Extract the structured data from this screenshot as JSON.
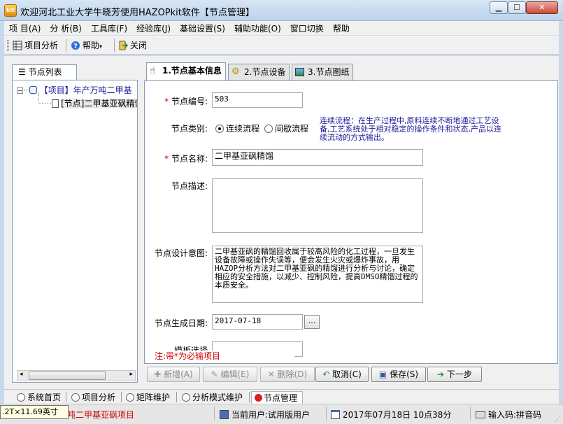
{
  "window": {
    "title": "欢迎河北工业大学牛晓芳使用HAZOPkit软件【节点管理】",
    "app_icon_text": "kit"
  },
  "menu": [
    "项 目(A)",
    "分 析(B)",
    "工具库(F)",
    "经验库(J)",
    "基础设置(S)",
    "辅助功能(O)",
    "窗口切换",
    "帮助"
  ],
  "toolbar": {
    "project_analysis": "项目分析",
    "help": "帮助",
    "close": "关闭"
  },
  "left_panel": {
    "tab_label": "节点列表",
    "tree": [
      {
        "label": "【项目】年产万吨二甲基",
        "level": 0
      },
      {
        "label": "[节点]二甲基亚砜精馏",
        "level": 1
      }
    ]
  },
  "tabs": [
    {
      "label": "1.节点基本信息",
      "active": true
    },
    {
      "label": "2.节点设备",
      "active": false
    },
    {
      "label": "3.节点图纸",
      "active": false
    }
  ],
  "form": {
    "node_number": {
      "label": "节点编号:",
      "value": "503"
    },
    "node_type": {
      "label": "节点类别:",
      "options": [
        {
          "label": "连续流程",
          "selected": true
        },
        {
          "label": "间歇流程",
          "selected": false
        }
      ],
      "hint": "连续流程：在生产过程中,原料连续不断地通过工艺设备,工艺系统处于相对稳定的操作条件和状态,产品以连续流动的方式输出。"
    },
    "node_name": {
      "label": "节点名称:",
      "value": "二甲基亚砜精馏"
    },
    "node_desc": {
      "label": "节点描述:",
      "value": ""
    },
    "design_intent": {
      "label": "节点设计意图:",
      "value": "二甲基亚砜的精馏回收属于较高风险的化工过程，一旦发生设备故障或操作失误等，便会发生火灾或爆炸事故，用HAZOP分析方法对二甲基亚砜的精馏进行分析与讨论，确定相应的安全措施，以减少、控制风险，提高DMSO精馏过程的本质安全。"
    },
    "gen_date": {
      "label": "节点生成日期:",
      "value": "2017-07-18",
      "picker": "..."
    },
    "next_label_partial": "模板选择",
    "required_note": "注:带*为必输项目"
  },
  "actions": [
    {
      "label": "新增(A)",
      "enabled": false,
      "icon": "plus-icon"
    },
    {
      "label": "编辑(E)",
      "enabled": false,
      "icon": "edit-icon"
    },
    {
      "label": "删除(D)",
      "enabled": false,
      "icon": "delete-icon"
    },
    {
      "label": "取消(C)",
      "enabled": true,
      "icon": "undo-icon"
    },
    {
      "label": "保存(S)",
      "enabled": true,
      "icon": "save-icon"
    },
    {
      "label": "下一步",
      "enabled": true,
      "icon": "next-icon"
    }
  ],
  "module_tabs": [
    {
      "label": "系统首页",
      "active": false
    },
    {
      "label": "项目分析",
      "active": false
    },
    {
      "label": "矩阵维护",
      "active": false
    },
    {
      "label": "分析模式维护",
      "active": false
    },
    {
      "label": "节点管理",
      "active": true
    }
  ],
  "statusbar": {
    "tooltip": ".2T×11.69英寸",
    "project": "吨二甲基亚砜项目",
    "user": "当前用户:试用版用户",
    "datetime": "2017年07月18日  10点38分",
    "input_method": "输入码:拼音码"
  },
  "colors": {
    "frame": "#c9d9ec",
    "required": "#d00000",
    "hint": "#1a1a9c",
    "active_dot": "#e02020"
  }
}
